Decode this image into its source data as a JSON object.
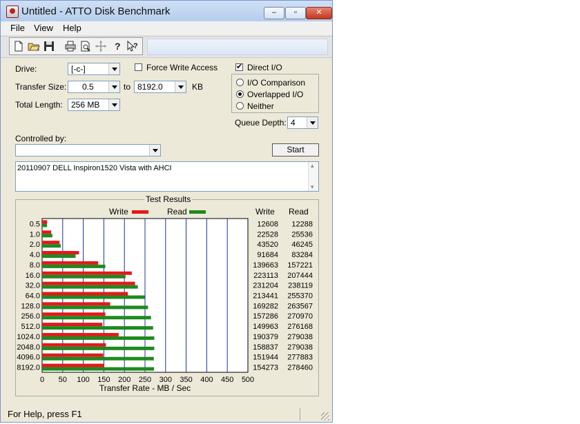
{
  "window": {
    "title": "Untitled - ATTO Disk Benchmark",
    "min_icon": "minimize-icon",
    "max_icon": "maximize-icon",
    "close_icon": "close-icon"
  },
  "menu": {
    "file": "File",
    "view": "View",
    "help": "Help"
  },
  "toolbar": {
    "icons": [
      "new-icon",
      "open-icon",
      "save-icon",
      "print-icon",
      "print-preview-icon",
      "move-icon",
      "help-icon",
      "context-help-icon"
    ]
  },
  "form": {
    "drive_label": "Drive:",
    "drive_value": "[-c-]",
    "force_write_label": "Force Write Access",
    "direct_io_label": "Direct I/O",
    "transfer_size_label": "Transfer Size:",
    "transfer_from": "0.5",
    "to_label": "to",
    "transfer_to": "8192.0",
    "kb_label": "KB",
    "total_length_label": "Total Length:",
    "total_length_value": "256 MB",
    "io_comparison": "I/O Comparison",
    "overlapped_io": "Overlapped I/O",
    "neither": "Neither",
    "queue_depth_label": "Queue Depth:",
    "queue_depth_value": "4",
    "controlled_by_label": "Controlled by:",
    "controlled_by_value": "",
    "start_label": "Start",
    "description": "20110907 DELL Inspiron1520 Vista with AHCI"
  },
  "results": {
    "title": "Test Results",
    "write_header": "Write",
    "read_header": "Read"
  },
  "chart_data": {
    "type": "bar",
    "orientation": "horizontal",
    "categories": [
      "0.5",
      "1.0",
      "2.0",
      "4.0",
      "8.0",
      "16.0",
      "32.0",
      "64.0",
      "128.0",
      "256.0",
      "512.0",
      "1024.0",
      "2048.0",
      "4096.0",
      "8192.0"
    ],
    "series": [
      {
        "name": "Write",
        "color": "#e01b1b",
        "values": [
          12608,
          22528,
          43520,
          91684,
          139663,
          223113,
          231204,
          213441,
          169282,
          157286,
          149963,
          190379,
          158837,
          151944,
          154273
        ]
      },
      {
        "name": "Read",
        "color": "#1e8a1e",
        "values": [
          12288,
          25536,
          46245,
          83284,
          157221,
          207444,
          238119,
          255370,
          263567,
          270970,
          276168,
          279038,
          279038,
          277883,
          278460
        ]
      }
    ],
    "xticks": [
      "0",
      "50",
      "100",
      "150",
      "200",
      "250",
      "300",
      "350",
      "400",
      "450",
      "500"
    ],
    "xlabel": "Transfer Rate - MB / Sec",
    "xlim": [
      0,
      500
    ],
    "grid": true,
    "legend": "top-center"
  },
  "status": {
    "text": "For Help, press F1"
  }
}
